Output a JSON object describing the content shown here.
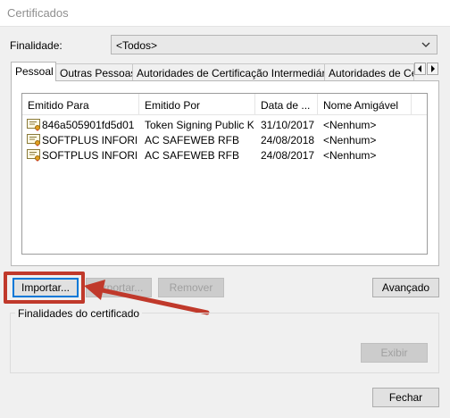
{
  "window": {
    "title": "Certificados"
  },
  "purpose": {
    "label": "Finalidade:",
    "value": "<Todos>"
  },
  "tabs": [
    {
      "label": "Pessoal",
      "active": true
    },
    {
      "label": "Outras Pessoas",
      "active": false
    },
    {
      "label": "Autoridades de Certificação Intermediárias",
      "active": false
    },
    {
      "label": "Autoridades de Ce",
      "active": false
    }
  ],
  "table": {
    "columns": [
      "Emitido Para",
      "Emitido Por",
      "Data de ...",
      "Nome Amigável"
    ],
    "rows": [
      {
        "issued_to": "846a505901fd5d01",
        "issued_by": "Token Signing Public Key",
        "expiry": "31/10/2017",
        "friendly_name": "<Nenhum>"
      },
      {
        "issued_to": "SOFTPLUS INFORM...",
        "issued_by": "AC SAFEWEB RFB",
        "expiry": "24/08/2018",
        "friendly_name": "<Nenhum>"
      },
      {
        "issued_to": "SOFTPLUS INFORM...",
        "issued_by": "AC SAFEWEB RFB",
        "expiry": "24/08/2017",
        "friendly_name": "<Nenhum>"
      }
    ],
    "row_icon": "certificate-icon"
  },
  "buttons": {
    "import": "Importar...",
    "export": "Exportar...",
    "remove": "Remover",
    "advanced": "Avançado",
    "view": "Exibir",
    "close": "Fechar"
  },
  "group": {
    "title": "Finalidades do certificado"
  },
  "annotation": {
    "color": "#c0392b",
    "shape": "arrow-and-box"
  }
}
